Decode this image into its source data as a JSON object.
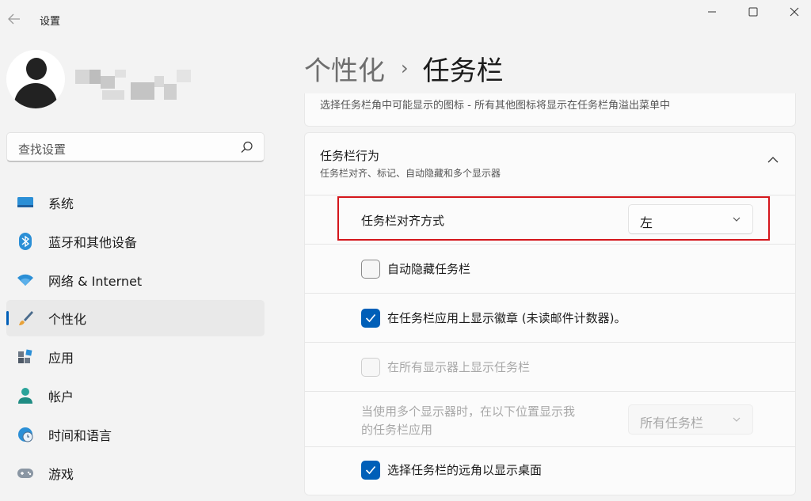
{
  "window": {
    "app_title": "设置"
  },
  "search": {
    "placeholder": "查找设置"
  },
  "sidebar": {
    "items": [
      {
        "label": "系统",
        "icon": "monitor-icon"
      },
      {
        "label": "蓝牙和其他设备",
        "icon": "bluetooth-icon"
      },
      {
        "label": "网络 & Internet",
        "icon": "wifi-icon"
      },
      {
        "label": "个性化",
        "icon": "brush-icon",
        "active": true
      },
      {
        "label": "应用",
        "icon": "apps-icon"
      },
      {
        "label": "帐户",
        "icon": "person-icon"
      },
      {
        "label": "时间和语言",
        "icon": "globe-clock-icon"
      },
      {
        "label": "游戏",
        "icon": "gamepad-icon"
      }
    ]
  },
  "breadcrumb": {
    "parent": "个性化",
    "separator": "›",
    "current": "任务栏"
  },
  "corner_overflow_card": {
    "description": "选择任务栏角中可能显示的图标 - 所有其他图标将显示在任务栏角溢出菜单中"
  },
  "taskbar_behavior": {
    "title": "任务栏行为",
    "subtitle": "任务栏对齐、标记、自动隐藏和多个显示器",
    "alignment": {
      "label": "任务栏对齐方式",
      "value": "左"
    },
    "auto_hide": {
      "label": "自动隐藏任务栏",
      "checked": false
    },
    "badges": {
      "label": "在任务栏应用上显示徽章 (未读邮件计数器)。",
      "checked": true
    },
    "all_displays": {
      "label": "在所有显示器上显示任务栏",
      "checked": false,
      "disabled": true
    },
    "multi_display": {
      "label_line1": "当使用多个显示器时，在以下位置显示我",
      "label_line2": "的任务栏应用",
      "value": "所有任务栏",
      "disabled": true
    },
    "far_corner": {
      "label": "选择任务栏的远角以显示桌面",
      "checked": true
    }
  },
  "colors": {
    "accent": "#005fb8",
    "highlight": "#d4161c"
  }
}
